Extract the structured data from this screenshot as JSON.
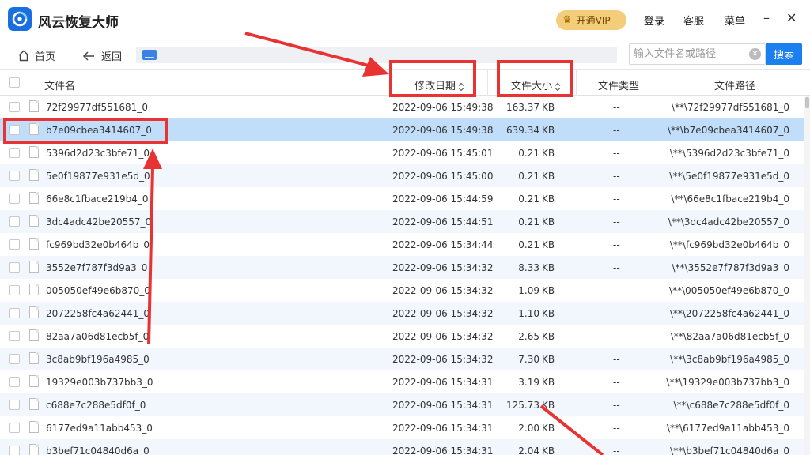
{
  "app": {
    "title": "风云恢复大师",
    "vip_label": "开通VIP",
    "login": "登录",
    "service": "客服",
    "menu": "菜单",
    "minimize": "–",
    "close": "✕"
  },
  "toolbar": {
    "home": "首页",
    "back": "返回",
    "search_placeholder": "输入文件名或路径",
    "search_button": "搜索"
  },
  "table": {
    "columns": {
      "name": "文件名",
      "date": "修改日期",
      "size": "文件大小",
      "type": "文件类型",
      "path": "文件路径"
    },
    "rows": [
      {
        "name": "72f29977df551681_0",
        "date": "2022-09-06 15:49:38",
        "size": "163.37",
        "unit": "KB",
        "type": "--",
        "path": "\\**\\72f29977df551681_0"
      },
      {
        "name": "b7e09cbea3414607_0",
        "date": "2022-09-06 15:49:38",
        "size": "639.34",
        "unit": "KB",
        "type": "--",
        "path": "\\**\\b7e09cbea3414607_0",
        "selected": true
      },
      {
        "name": "5396d2d23c3bfe71_0",
        "date": "2022-09-06 15:45:01",
        "size": "0.21",
        "unit": "KB",
        "type": "--",
        "path": "\\**\\5396d2d23c3bfe71_0"
      },
      {
        "name": "5e0f19877e931e5d_0",
        "date": "2022-09-06 15:45:00",
        "size": "0.21",
        "unit": "KB",
        "type": "--",
        "path": "\\**\\5e0f19877e931e5d_0"
      },
      {
        "name": "66e8c1fbace219b4_0",
        "date": "2022-09-06 15:44:59",
        "size": "0.21",
        "unit": "KB",
        "type": "--",
        "path": "\\**\\66e8c1fbace219b4_0"
      },
      {
        "name": "3dc4adc42be20557_0",
        "date": "2022-09-06 15:44:51",
        "size": "0.21",
        "unit": "KB",
        "type": "--",
        "path": "\\**\\3dc4adc42be20557_0"
      },
      {
        "name": "fc969bd32e0b464b_0",
        "date": "2022-09-06 15:34:44",
        "size": "0.21",
        "unit": "KB",
        "type": "--",
        "path": "\\**\\fc969bd32e0b464b_0"
      },
      {
        "name": "3552e7f787f3d9a3_0",
        "date": "2022-09-06 15:34:32",
        "size": "8.33",
        "unit": "KB",
        "type": "--",
        "path": "\\**\\3552e7f787f3d9a3_0"
      },
      {
        "name": "005050ef49e6b870_0",
        "date": "2022-09-06 15:34:32",
        "size": "1.09",
        "unit": "KB",
        "type": "--",
        "path": "\\**\\005050ef49e6b870_0"
      },
      {
        "name": "2072258fc4a62441_0",
        "date": "2022-09-06 15:34:32",
        "size": "1.10",
        "unit": "KB",
        "type": "--",
        "path": "\\**\\2072258fc4a62441_0"
      },
      {
        "name": "82aa7a06d81ecb5f_0",
        "date": "2022-09-06 15:34:32",
        "size": "2.65",
        "unit": "KB",
        "type": "--",
        "path": "\\**\\82aa7a06d81ecb5f_0"
      },
      {
        "name": "3c8ab9bf196a4985_0",
        "date": "2022-09-06 15:34:32",
        "size": "7.30",
        "unit": "KB",
        "type": "--",
        "path": "\\**\\3c8ab9bf196a4985_0"
      },
      {
        "name": "19329e003b737bb3_0",
        "date": "2022-09-06 15:34:31",
        "size": "3.19",
        "unit": "KB",
        "type": "--",
        "path": "\\**\\19329e003b737bb3_0"
      },
      {
        "name": "c688e7c288e5df0f_0",
        "date": "2022-09-06 15:34:31",
        "size": "125.73",
        "unit": "KB",
        "type": "--",
        "path": "\\**\\c688e7c288e5df0f_0"
      },
      {
        "name": "6177ed9a11abb453_0",
        "date": "2022-09-06 15:34:31",
        "size": "2.00",
        "unit": "KB",
        "type": "--",
        "path": "\\**\\6177ed9a11abb453_0"
      },
      {
        "name": "b3bef71c04840d6a_0",
        "date": "2022-09-06 15:34:31",
        "size": "2.04",
        "unit": "KB",
        "type": "--",
        "path": "\\**\\b3bef71c04840d6a_0"
      }
    ]
  },
  "colors": {
    "accent": "#1c7ff0",
    "selected_row": "#c0ddfa",
    "alt_row": "#f1f7fd",
    "annotation": "#e93232",
    "vip": "#f3cd7a"
  }
}
